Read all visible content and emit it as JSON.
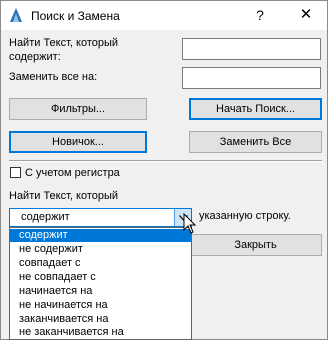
{
  "window": {
    "title": "Поиск и Замена",
    "help": "?",
    "close": "✕"
  },
  "find": {
    "label": "Найти Текст, который содержит:",
    "value": ""
  },
  "replace": {
    "label": "Заменить все на:",
    "value": ""
  },
  "buttons": {
    "filters": "Фильтры...",
    "start_search": "Начать Поиск...",
    "newbie": "Новичок...",
    "replace_all": "Заменить Все",
    "close": "Закрыть"
  },
  "case_sensitive": {
    "label": "С учетом регистра",
    "checked": false
  },
  "find_text_label": "Найти Текст, который",
  "combo": {
    "selected": "содержит",
    "suffix": "указанную строку.",
    "options": [
      "содержит",
      "не содержит",
      "совпадает с",
      "не совпадает с",
      "начинается на",
      "не начинается на",
      "заканчивается на",
      "не заканчивается на"
    ]
  },
  "colors": {
    "accent": "#0078d7",
    "face": "#f0f0f0"
  }
}
